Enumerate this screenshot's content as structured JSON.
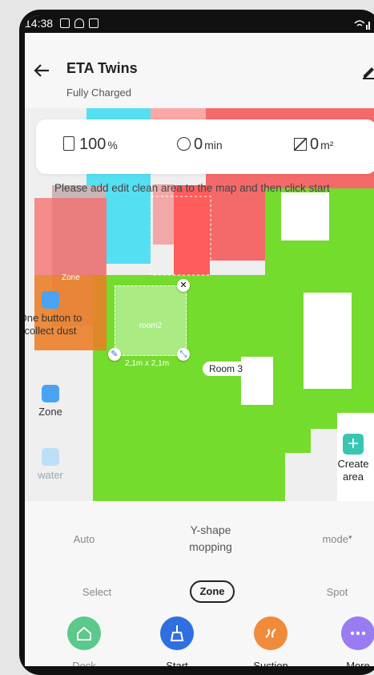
{
  "status_bar": {
    "time": "14:38"
  },
  "header": {
    "title": "ETA Twins",
    "subtitle": "Fully Charged"
  },
  "stats": {
    "battery_value": "100",
    "battery_unit": "%",
    "time_value": "0",
    "time_unit": "min",
    "area_value": "0",
    "area_unit": "m²"
  },
  "hint": "Please add edit clean area to the map and then click start",
  "map": {
    "zone_label": "Zone",
    "room_zone_label": "room2",
    "zone_size": "2,1m x 2,1m",
    "room_tag": "Room 3"
  },
  "side_buttons": [
    {
      "label": "One button to collect dust",
      "icon": "dustbin-icon"
    },
    {
      "label": "Zone",
      "icon": "zone-icon"
    },
    {
      "label": "water",
      "icon": "water-drop-icon"
    }
  ],
  "create_area": {
    "label": "Create area",
    "icon": "plus-icon"
  },
  "modes": {
    "auto": "Auto",
    "yshape": "Y-shape mopping",
    "mode": "mode",
    "select": "Select",
    "zone": "Zone",
    "spot": "Spot"
  },
  "actions": [
    {
      "label": "Dock",
      "color": "#5ac98a",
      "icon": "home-icon"
    },
    {
      "label": "Start",
      "color": "#2f6fe0",
      "icon": "broom-icon"
    },
    {
      "label": "Suction",
      "color": "#f08b3c",
      "icon": "fan-icon"
    },
    {
      "label": "More",
      "color": "#9a7cf2",
      "icon": "more-icon"
    }
  ],
  "colors": {
    "map_green": "#74dc2c",
    "room_cyan": "#55dff2",
    "room_red": "#f46a6a",
    "accent_blue": "#4aa3f2"
  }
}
